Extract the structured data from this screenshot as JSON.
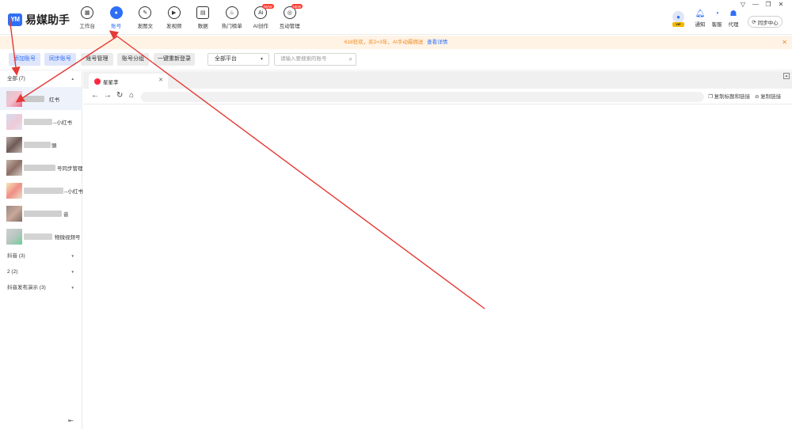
{
  "app": {
    "logo_mark": "YM",
    "name": "易媒助手"
  },
  "nav": [
    {
      "label": "工作台",
      "glyph": "▦"
    },
    {
      "label": "账号",
      "glyph": "●"
    },
    {
      "label": "发图文",
      "glyph": "✎"
    },
    {
      "label": "发视频",
      "glyph": "▶"
    },
    {
      "label": "数据",
      "glyph": "▤"
    },
    {
      "label": "热门榜单",
      "glyph": "♨"
    },
    {
      "label": "AI创作",
      "glyph": "Ai",
      "badge": "NEW"
    },
    {
      "label": "互动管理",
      "glyph": "◎",
      "badge": "NEW"
    }
  ],
  "topright": {
    "vip": "VIP",
    "notify": "通知",
    "service": "客服",
    "agent": "代理",
    "sync_center": "同步中心"
  },
  "notice": {
    "text": "618狂欢，买2=3年，AI手动薅佣送",
    "link": "查看详情"
  },
  "toolbar": {
    "add_account": "添加账号",
    "sync_account": "同步账号",
    "account_manage": "账号管理",
    "account_group": "账号分组",
    "relogin": "一键重新登录",
    "platform": "全部平台",
    "search_placeholder": "请输入要搜索的账号"
  },
  "sidebar": {
    "group_all": "全部 (7)",
    "accounts": [
      {
        "name": "红书"
      },
      {
        "name": "--小红书"
      },
      {
        "name": "頭"
      },
      {
        "name": "号同步管理"
      },
      {
        "name": "--小红书"
      },
      {
        "name": "音"
      },
      {
        "name": "物微视频号"
      }
    ],
    "groups": [
      {
        "label": "抖音 (3)"
      },
      {
        "label": "2 (2)"
      },
      {
        "label": "抖音发布演示 (3)"
      }
    ]
  },
  "browser": {
    "tab_title": "星星李",
    "copy_title_link": "复制标题和链接",
    "copy_link": "复制链接"
  }
}
